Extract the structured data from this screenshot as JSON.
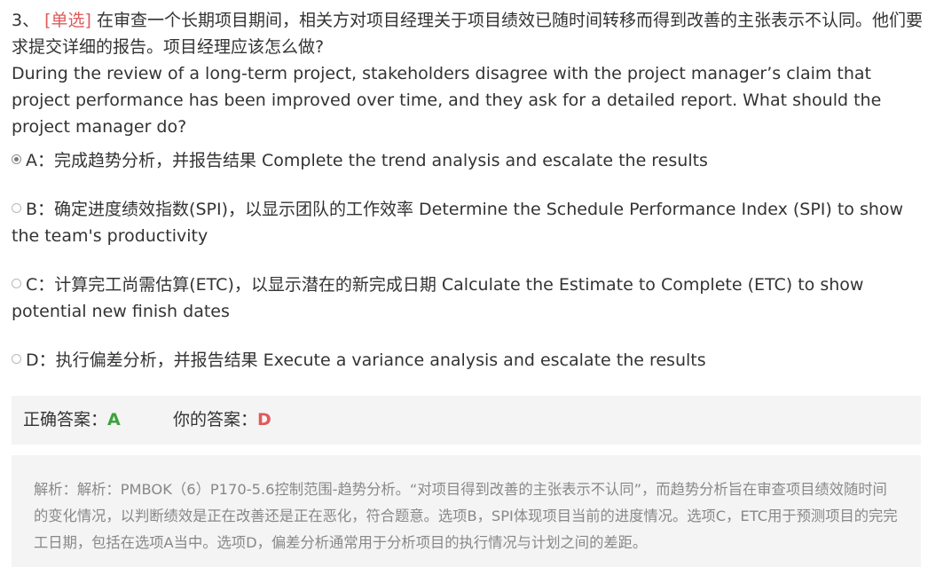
{
  "question": {
    "number": "3、",
    "type_label": "[单选]",
    "text_cn": "在审查一个长期项目期间，相关方对项目经理关于项目绩效已随时间转移而得到改善的主张表示不认同。他们要求提交详细的报告。项目经理应该怎么做?",
    "text_en": "During the review of a long-term project, stakeholders disagree with the project manager’s claim that project performance has been improved over time, and they ask for a detailed report. What should the project manager do?"
  },
  "options": [
    {
      "letter": "A",
      "text": "A：完成趋势分析，并报告结果 Complete the trend analysis and escalate the results",
      "selected": true
    },
    {
      "letter": "B",
      "text": "B：确定进度绩效指数(SPI)，以显示团队的工作效率 Determine the Schedule Performance Index (SPI) to show the team's productivity",
      "selected": false
    },
    {
      "letter": "C",
      "text": "C：计算完工尚需估算(ETC)，以显示潜在的新完成日期 Calculate the Estimate to Complete (ETC) to show potential new finish dates",
      "selected": false
    },
    {
      "letter": "D",
      "text": "D：执行偏差分析，并报告结果 Execute a variance analysis and escalate the results",
      "selected": false
    }
  ],
  "answer": {
    "correct_label": "正确答案：",
    "correct_value": "A",
    "user_label": "你的答案：",
    "user_value": "D",
    "correct_color": "#3ca33c",
    "user_color": "#e05a5a"
  },
  "analysis": {
    "text": "解析：解析：PMBOK（6）P170-5.6控制范围-趋势分析。“对项目得到改善的主张表示不认同”，而趋势分析旨在审查项目绩效随时间的变化情况，以判断绩效是正在改善还是正在恶化，符合题意。选项B，SPI体现项目当前的进度情况。选项C，ETC用于预测项目的完完工日期，包括在选项A当中。选项D，偏差分析通常用于分析项目的执行情况与计划之间的差距。"
  },
  "colors": {
    "type_label": "#e05a5a",
    "panel_background": "#f4f4f4",
    "analysis_text": "#888888"
  },
  "icons": {
    "radio_checked": "radio-checked-icon",
    "radio_unchecked": "radio-unchecked-icon"
  }
}
